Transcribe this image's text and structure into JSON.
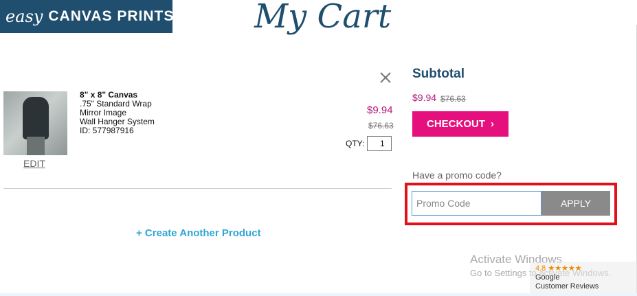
{
  "header": {
    "logo_script": "easy",
    "logo_text": "CANVAS PRINTS",
    "title": "My Cart"
  },
  "cart": {
    "item": {
      "name": "8\" x 8\" Canvas",
      "options": [
        ".75\" Standard Wrap",
        "Mirror Image",
        "Wall Hanger System"
      ],
      "id_text": "ID: 577987916",
      "edit_label": "EDIT",
      "price": "$9.94",
      "original_price": "$76.63",
      "qty_label": "QTY:",
      "qty_value": "1"
    },
    "create_label": "+ Create Another Product"
  },
  "summary": {
    "title": "Subtotal",
    "price": "$9.94",
    "original_price": "$76.63",
    "checkout_label": "CHECKOUT"
  },
  "promo": {
    "label": "Have a promo code?",
    "placeholder": "Promo Code",
    "apply_label": "APPLY"
  },
  "overlay": {
    "activate_title": "Activate Windows",
    "activate_sub": "Go to Settings to activate Windows."
  },
  "reviews": {
    "rating": "4.8 ★★★★★",
    "line1": "Google",
    "line2": "Customer Reviews"
  },
  "colors": {
    "brand_blue": "#1f4e6e",
    "price_magenta": "#b2167a",
    "checkout_pink": "#e60f7e",
    "link_blue": "#2fa6d6",
    "highlight_red": "#e1111b"
  },
  "icons": {
    "remove": "close-icon",
    "checkout": "chevron-right-icon"
  }
}
